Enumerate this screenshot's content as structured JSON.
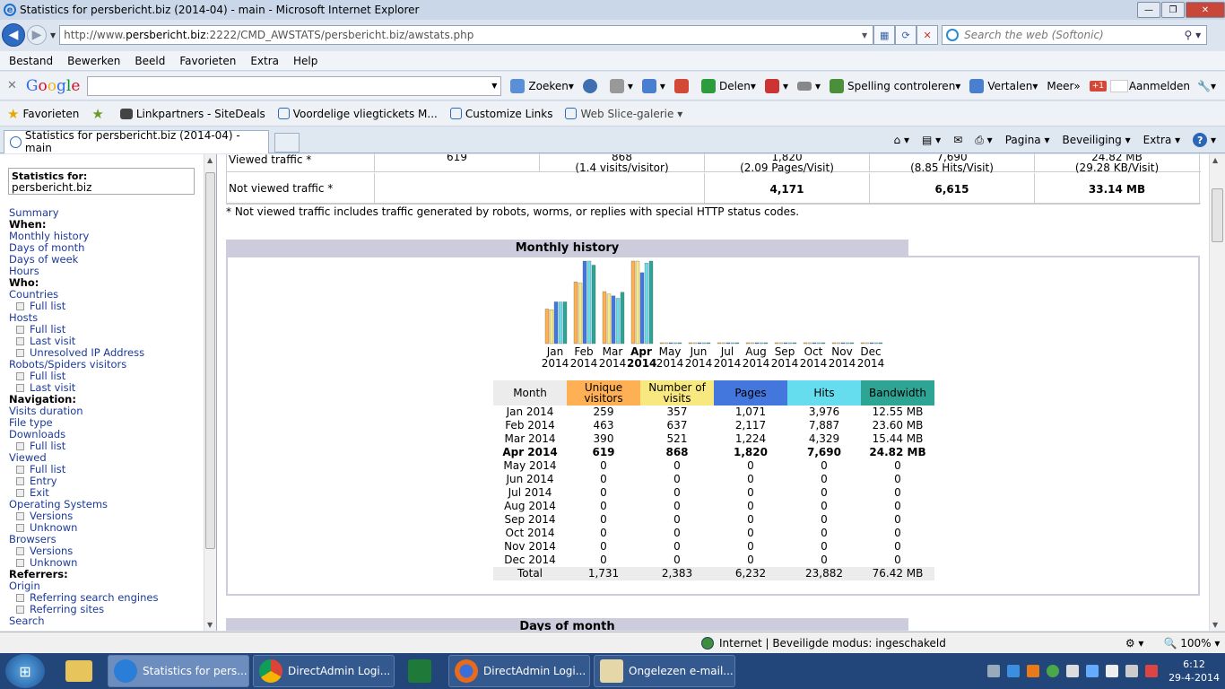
{
  "window": {
    "title": "Statistics for persbericht.biz (2014-04) - main - Microsoft Internet Explorer"
  },
  "address": {
    "url_prefix": "http://www.",
    "url_domain": "persbericht.biz",
    "url_rest": ":2222/CMD_AWSTATS/persbericht.biz/awstats.php"
  },
  "search": {
    "placeholder": "Search the web (Softonic)"
  },
  "menu": [
    "Bestand",
    "Bewerken",
    "Beeld",
    "Favorieten",
    "Extra",
    "Help"
  ],
  "google_bar": {
    "logo": "Google",
    "search_label": "Zoeken",
    "share_label": "Delen",
    "spell_label": "Spelling controleren",
    "translate_label": "Vertalen",
    "more_label": "Meer",
    "gplus_label": "+1",
    "signin_label": "Aanmelden"
  },
  "favorites": {
    "label": "Favorieten",
    "items": [
      "Linkpartners - SiteDeals",
      "Voordelige vliegtickets M...",
      "Customize Links",
      "Web Slice-galerie"
    ]
  },
  "tab": {
    "label": "Statistics for persbericht.biz (2014-04) - main"
  },
  "command_bar": {
    "page": "Pagina",
    "security": "Beveiliging",
    "extra": "Extra"
  },
  "sidebar": {
    "stat_header": "Statistics for:",
    "stat_domain": "persbericht.biz",
    "items": [
      {
        "t": "Summary",
        "k": "lnk"
      },
      {
        "t": "When:",
        "k": "hd"
      },
      {
        "t": "Monthly history",
        "k": "lnk"
      },
      {
        "t": "Days of month",
        "k": "lnk"
      },
      {
        "t": "Days of week",
        "k": "lnk"
      },
      {
        "t": "Hours",
        "k": "lnk"
      },
      {
        "t": "Who:",
        "k": "hd"
      },
      {
        "t": "Countries",
        "k": "lnk"
      },
      {
        "t": "Full list",
        "k": "sub"
      },
      {
        "t": "Hosts",
        "k": "lnk"
      },
      {
        "t": "Full list",
        "k": "sub"
      },
      {
        "t": "Last visit",
        "k": "sub"
      },
      {
        "t": "Unresolved IP Address",
        "k": "sub"
      },
      {
        "t": "Robots/Spiders visitors",
        "k": "lnk"
      },
      {
        "t": "Full list",
        "k": "sub"
      },
      {
        "t": "Last visit",
        "k": "sub"
      },
      {
        "t": "Navigation:",
        "k": "hd"
      },
      {
        "t": "Visits duration",
        "k": "lnk"
      },
      {
        "t": "File type",
        "k": "lnk"
      },
      {
        "t": "Downloads",
        "k": "lnk"
      },
      {
        "t": "Full list",
        "k": "sub"
      },
      {
        "t": "Viewed",
        "k": "lnk"
      },
      {
        "t": "Full list",
        "k": "sub"
      },
      {
        "t": "Entry",
        "k": "sub"
      },
      {
        "t": "Exit",
        "k": "sub"
      },
      {
        "t": "Operating Systems",
        "k": "lnk"
      },
      {
        "t": "Versions",
        "k": "sub"
      },
      {
        "t": "Unknown",
        "k": "sub"
      },
      {
        "t": "Browsers",
        "k": "lnk"
      },
      {
        "t": "Versions",
        "k": "sub"
      },
      {
        "t": "Unknown",
        "k": "sub"
      },
      {
        "t": "Referrers:",
        "k": "hd"
      },
      {
        "t": "Origin",
        "k": "lnk"
      },
      {
        "t": "Referring search engines",
        "k": "sub"
      },
      {
        "t": "Referring sites",
        "k": "sub"
      },
      {
        "t": "Search",
        "k": "lnk"
      }
    ]
  },
  "traffic": {
    "viewed_label": "Viewed traffic *",
    "viewed": [
      "619",
      "868\n(1.4 visits/visitor)",
      "1,820\n(2.09 Pages/Visit)",
      "7,690\n(8.85 Hits/Visit)",
      "24.82 MB\n(29.28 KB/Visit)"
    ],
    "not_viewed_label": "Not viewed traffic *",
    "not_viewed": [
      "",
      "",
      "4,171",
      "6,615",
      "33.14 MB"
    ],
    "note": "* Not viewed traffic includes traffic generated by robots, worms, or replies with special HTTP status codes."
  },
  "monthly": {
    "title": "Monthly history",
    "next_title": "Days of month",
    "headers": [
      "Month",
      "Unique visitors",
      "Number of visits",
      "Pages",
      "Hits",
      "Bandwidth"
    ],
    "header_colors": [
      "#ececec",
      "#ffb055",
      "#f8e880",
      "#4477dd",
      "#66ddee",
      "#2ea495"
    ],
    "rows": [
      [
        "Jan 2014",
        "259",
        "357",
        "1,071",
        "3,976",
        "12.55 MB"
      ],
      [
        "Feb 2014",
        "463",
        "637",
        "2,117",
        "7,887",
        "23.60 MB"
      ],
      [
        "Mar 2014",
        "390",
        "521",
        "1,224",
        "4,329",
        "15.44 MB"
      ],
      [
        "Apr 2014",
        "619",
        "868",
        "1,820",
        "7,690",
        "24.82 MB"
      ],
      [
        "May 2014",
        "0",
        "0",
        "0",
        "0",
        "0"
      ],
      [
        "Jun 2014",
        "0",
        "0",
        "0",
        "0",
        "0"
      ],
      [
        "Jul 2014",
        "0",
        "0",
        "0",
        "0",
        "0"
      ],
      [
        "Aug 2014",
        "0",
        "0",
        "0",
        "0",
        "0"
      ],
      [
        "Sep 2014",
        "0",
        "0",
        "0",
        "0",
        "0"
      ],
      [
        "Oct 2014",
        "0",
        "0",
        "0",
        "0",
        "0"
      ],
      [
        "Nov 2014",
        "0",
        "0",
        "0",
        "0",
        "0"
      ],
      [
        "Dec 2014",
        "0",
        "0",
        "0",
        "0",
        "0"
      ]
    ],
    "total": [
      "Total",
      "1,731",
      "2,383",
      "6,232",
      "23,882",
      "76.42 MB"
    ],
    "month_labels": [
      [
        "Jan",
        "2014"
      ],
      [
        "Feb",
        "2014"
      ],
      [
        "Mar",
        "2014"
      ],
      [
        "Apr",
        "2014"
      ],
      [
        "May",
        "2014"
      ],
      [
        "Jun",
        "2014"
      ],
      [
        "Jul",
        "2014"
      ],
      [
        "Aug",
        "2014"
      ],
      [
        "Sep",
        "2014"
      ],
      [
        "Oct",
        "2014"
      ],
      [
        "Nov",
        "2014"
      ],
      [
        "Dec",
        "2014"
      ]
    ],
    "current_month": "Apr"
  },
  "chart_data": {
    "type": "bar",
    "categories": [
      "Jan 2014",
      "Feb 2014",
      "Mar 2014",
      "Apr 2014",
      "May 2014",
      "Jun 2014",
      "Jul 2014",
      "Aug 2014",
      "Sep 2014",
      "Oct 2014",
      "Nov 2014",
      "Dec 2014"
    ],
    "series": [
      {
        "name": "Unique visitors",
        "color": "#ffb055",
        "values": [
          259,
          463,
          390,
          619,
          0,
          0,
          0,
          0,
          0,
          0,
          0,
          0
        ]
      },
      {
        "name": "Number of visits",
        "color": "#f8e880",
        "values": [
          357,
          637,
          521,
          868,
          0,
          0,
          0,
          0,
          0,
          0,
          0,
          0
        ]
      },
      {
        "name": "Pages",
        "color": "#4477dd",
        "values": [
          1071,
          2117,
          1224,
          1820,
          0,
          0,
          0,
          0,
          0,
          0,
          0,
          0
        ]
      },
      {
        "name": "Hits",
        "color": "#66ddee",
        "values": [
          3976,
          7887,
          4329,
          7690,
          0,
          0,
          0,
          0,
          0,
          0,
          0,
          0
        ]
      },
      {
        "name": "Bandwidth",
        "color": "#2ea495",
        "values": [
          12.55,
          23.6,
          15.44,
          24.82,
          0,
          0,
          0,
          0,
          0,
          0,
          0,
          0
        ]
      }
    ]
  },
  "status": {
    "zone": "Internet | Beveiligde modus: ingeschakeld",
    "zoom": "100%"
  },
  "taskbar": {
    "items": [
      "Statistics for pers...",
      "DirectAdmin Logi...",
      "DirectAdmin Logi...",
      "Ongelezen e-mail..."
    ],
    "time": "6:12",
    "date": "29-4-2014"
  }
}
